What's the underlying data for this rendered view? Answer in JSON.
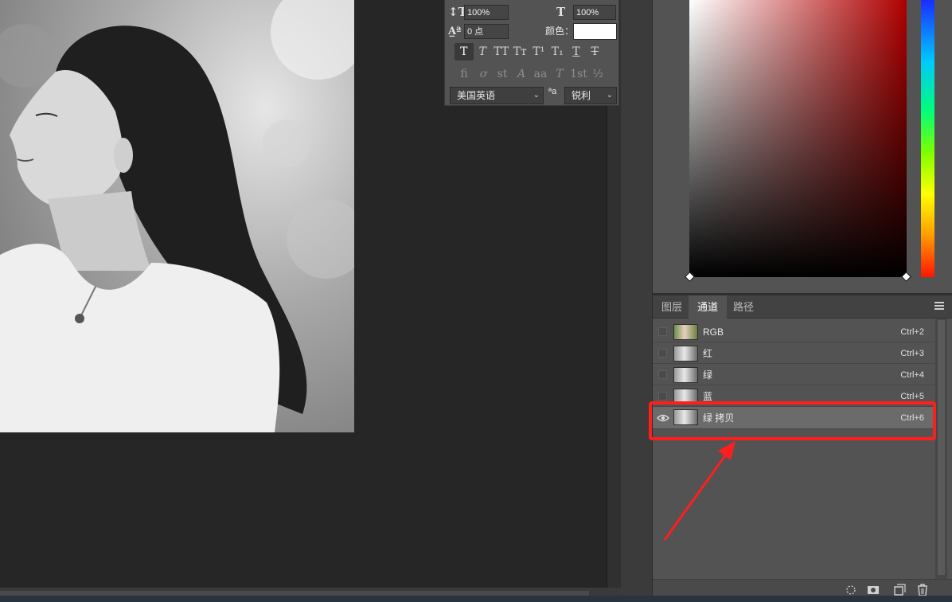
{
  "character_panel": {
    "vertical_scale": "100%",
    "horizontal_scale": "100%",
    "baseline_shift": "0 点",
    "color_label": "颜色：",
    "style_buttons": [
      {
        "glyph": "T",
        "name": "faux-bold"
      },
      {
        "glyph": "T",
        "name": "faux-italic"
      },
      {
        "glyph": "TT",
        "name": "all-caps"
      },
      {
        "glyph": "Tт",
        "name": "small-caps"
      },
      {
        "glyph": "T¹",
        "name": "superscript"
      },
      {
        "glyph": "T₁",
        "name": "subscript"
      },
      {
        "glyph": "T",
        "name": "underline"
      },
      {
        "glyph": "T",
        "name": "strikethrough"
      }
    ],
    "opentype_buttons": [
      {
        "glyph": "ﬁ",
        "name": "ligatures"
      },
      {
        "glyph": "ơ",
        "name": "discretionary-ligatures"
      },
      {
        "glyph": "st",
        "name": "stylistic-alternates"
      },
      {
        "glyph": "A",
        "name": "swash"
      },
      {
        "glyph": "aa",
        "name": "titling-alternates"
      },
      {
        "glyph": "T",
        "name": "contextual-alternates"
      },
      {
        "glyph": "1st",
        "name": "ordinals"
      },
      {
        "glyph": "½",
        "name": "fractions"
      }
    ],
    "language": "美国英语",
    "aa_icon_text": "ªa",
    "antialias": "锐利"
  },
  "channels_panel": {
    "tabs": [
      {
        "label": "图层",
        "active": false
      },
      {
        "label": "通道",
        "active": true
      },
      {
        "label": "路径",
        "active": false
      }
    ],
    "channels": [
      {
        "name": "RGB",
        "shortcut": "Ctrl+2",
        "visible": false,
        "selected": false,
        "thumb": "color"
      },
      {
        "name": "红",
        "shortcut": "Ctrl+3",
        "visible": false,
        "selected": false,
        "thumb": "gray"
      },
      {
        "name": "绿",
        "shortcut": "Ctrl+4",
        "visible": false,
        "selected": false,
        "thumb": "gray"
      },
      {
        "name": "蓝",
        "shortcut": "Ctrl+5",
        "visible": false,
        "selected": false,
        "thumb": "gray"
      },
      {
        "name": "绿 拷贝",
        "shortcut": "Ctrl+6",
        "visible": true,
        "selected": true,
        "thumb": "gray"
      }
    ],
    "footer_icons": [
      "load-selection-icon",
      "save-selection-icon",
      "new-channel-icon",
      "delete-channel-icon"
    ]
  },
  "colors": {
    "annotation": "#ff1e1e",
    "panel_bg": "#535353",
    "canvas_bg": "#262626"
  }
}
